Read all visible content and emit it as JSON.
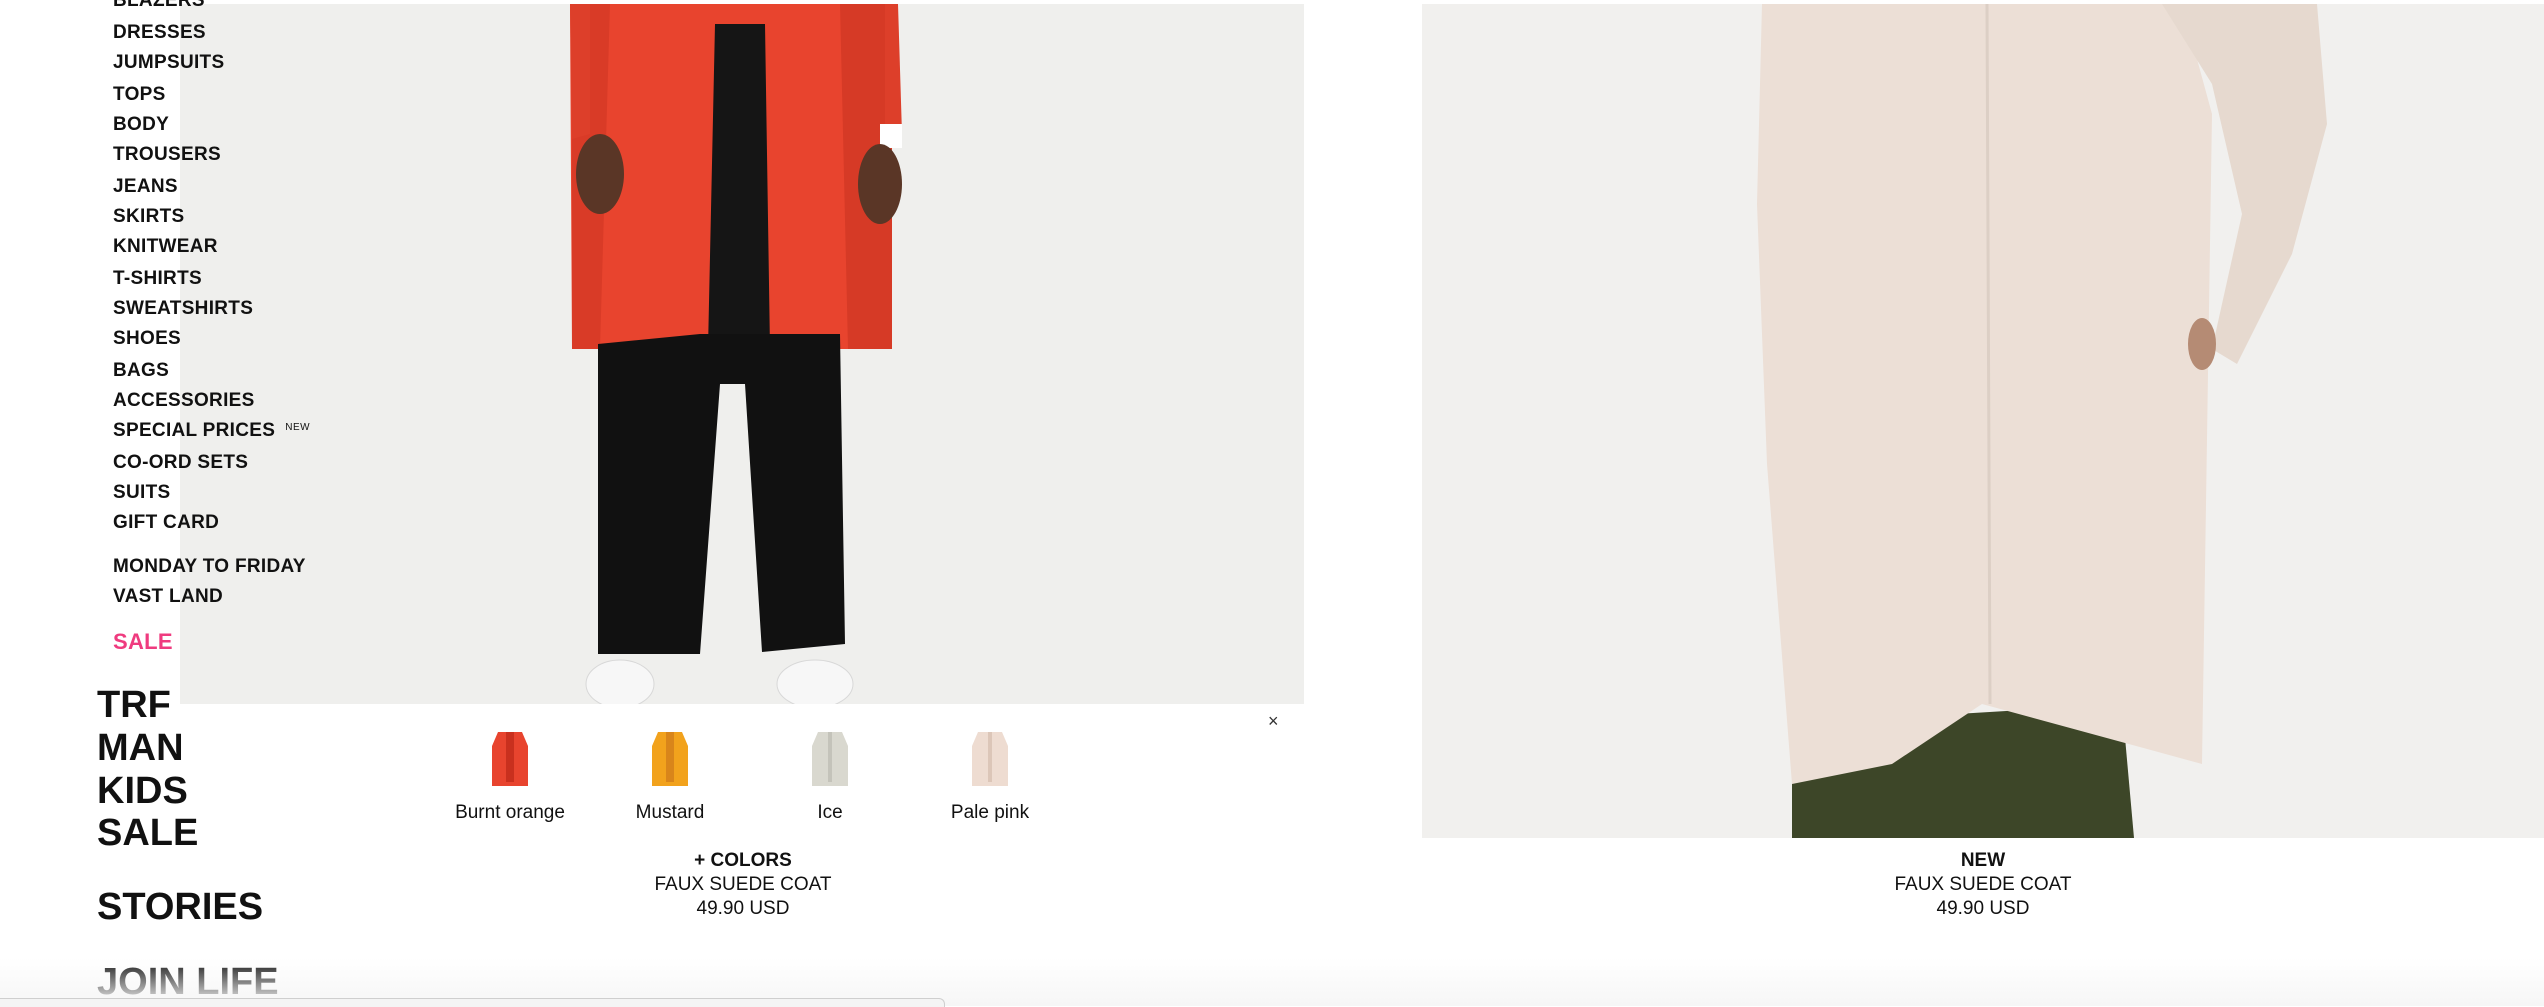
{
  "subnav": {
    "items": [
      {
        "label": "BLAZERS"
      },
      {
        "label": "DRESSES"
      },
      {
        "label": "JUMPSUITS"
      },
      {
        "label": "TOPS"
      },
      {
        "label": "BODY"
      },
      {
        "label": "TROUSERS"
      },
      {
        "label": "JEANS"
      },
      {
        "label": "SKIRTS"
      },
      {
        "label": "KNITWEAR"
      },
      {
        "label": "T-SHIRTS"
      },
      {
        "label": "SWEATSHIRTS"
      },
      {
        "label": "SHOES"
      },
      {
        "label": "BAGS"
      },
      {
        "label": "ACCESSORIES"
      },
      {
        "label": "SPECIAL PRICES",
        "badge": "NEW"
      },
      {
        "label": "CO-ORD SETS"
      },
      {
        "label": "SUITS"
      },
      {
        "label": "GIFT CARD"
      },
      {
        "label": "MONDAY TO FRIDAY"
      },
      {
        "label": "VAST LAND"
      },
      {
        "label": "SALE"
      }
    ]
  },
  "mainnav": {
    "items": [
      {
        "label": "TRF"
      },
      {
        "label": "MAN"
      },
      {
        "label": "KIDS"
      },
      {
        "label": "SALE"
      },
      {
        "label": "STORIES"
      },
      {
        "label": "JOIN LIFE"
      }
    ]
  },
  "swatches": {
    "close_label": "×",
    "colors": [
      {
        "label": "Burnt orange",
        "color": "#e8442e"
      },
      {
        "label": "Mustard",
        "color": "#f2a21c"
      },
      {
        "label": "Ice",
        "color": "#d9d8cf"
      },
      {
        "label": "Pale pink",
        "color": "#eedcd1"
      }
    ]
  },
  "products": [
    {
      "tag": "+ COLORS",
      "name": "FAUX SUEDE COAT",
      "price": "49.90 USD"
    },
    {
      "tag": "NEW",
      "name": "FAUX SUEDE COAT",
      "price": "49.90 USD"
    }
  ],
  "colors": {
    "sale_accent": "#ef3b7f",
    "coat_left": "#e8442e",
    "coat_right": "#ecdfd6",
    "trousers_right": "#3d4628"
  }
}
